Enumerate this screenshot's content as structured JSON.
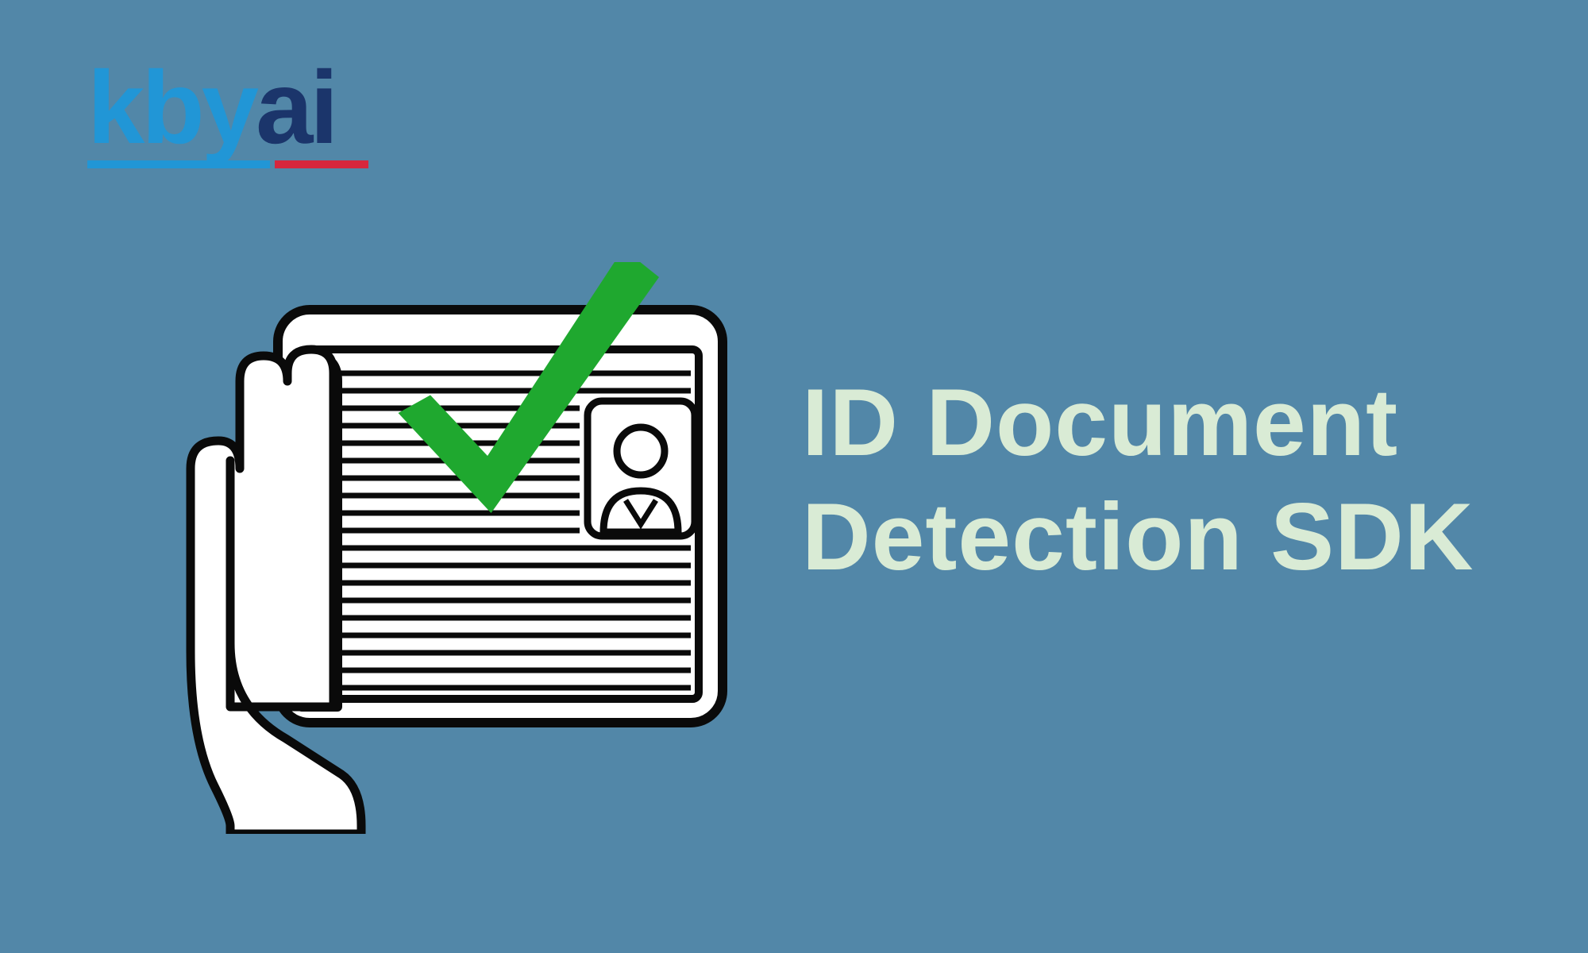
{
  "logo": {
    "part1": "kby",
    "part2": "ai"
  },
  "headline": {
    "line1": "ID Document",
    "line2": "Detection SDK"
  },
  "colors": {
    "background": "#5287a8",
    "headline": "#d9ebd5",
    "logo_primary": "#2196d6",
    "logo_secondary": "#1b356b",
    "accent_red": "#d7263d",
    "checkmark": "#1fa82f"
  }
}
